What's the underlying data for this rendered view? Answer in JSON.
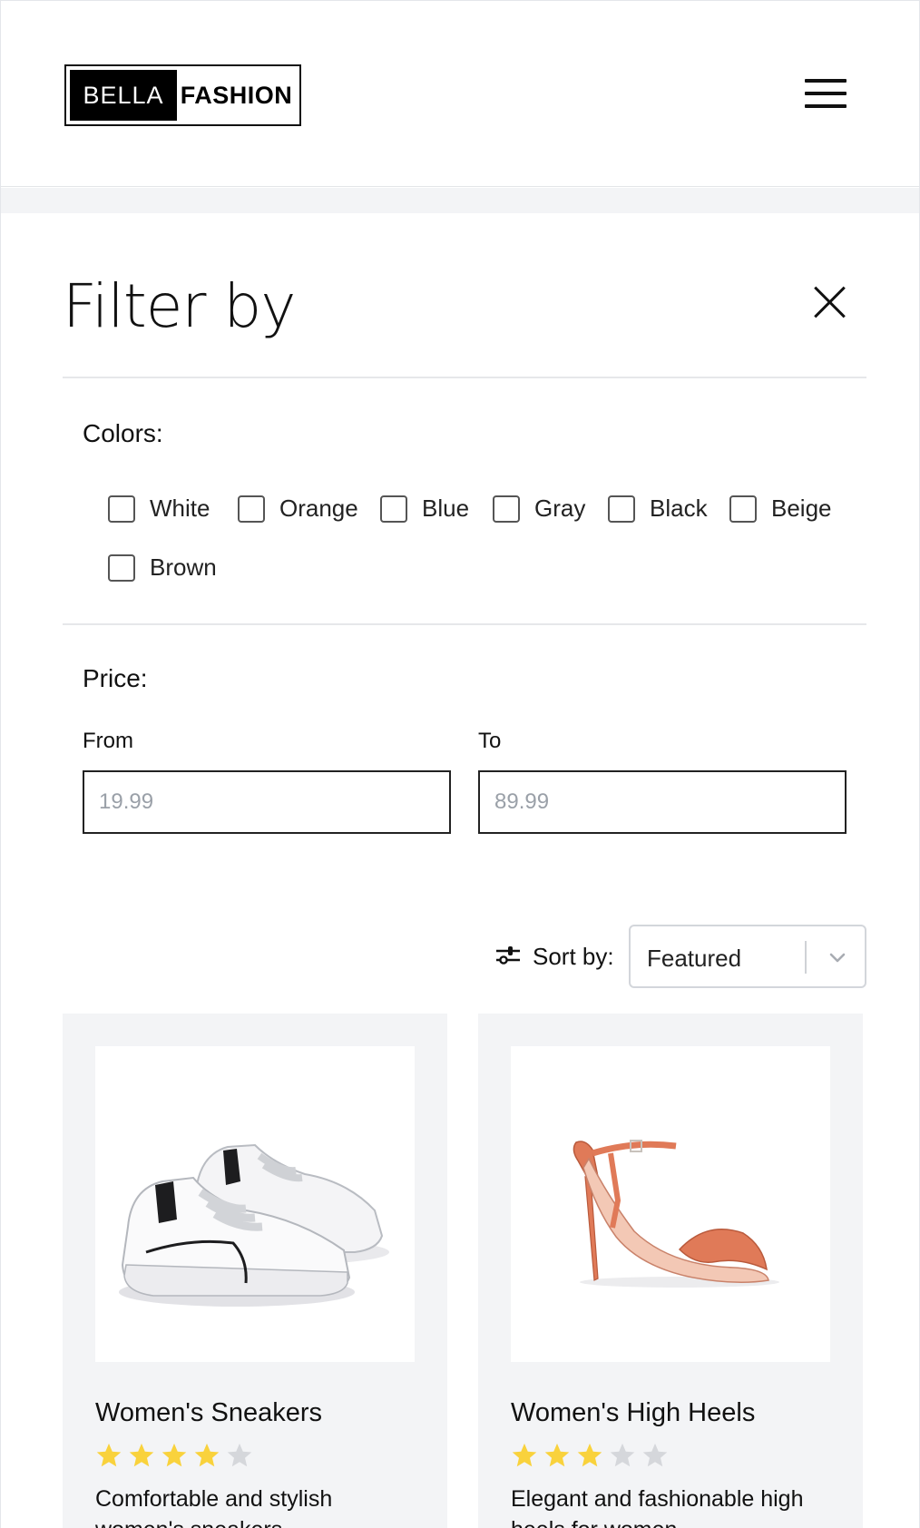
{
  "header": {
    "logo_left": "BELLA",
    "logo_right": "FASHION",
    "menu_icon": "hamburger-menu-icon"
  },
  "filter": {
    "title": "Filter by",
    "close_icon": "close-icon",
    "colors_label": "Colors:",
    "colors": [
      {
        "label": "White",
        "checked": false
      },
      {
        "label": "Orange",
        "checked": false
      },
      {
        "label": "Blue",
        "checked": false
      },
      {
        "label": "Gray",
        "checked": false
      },
      {
        "label": "Black",
        "checked": false
      },
      {
        "label": "Beige",
        "checked": false
      },
      {
        "label": "Brown",
        "checked": false
      }
    ],
    "price_label": "Price:",
    "from_label": "From",
    "from_placeholder": "19.99",
    "to_label": "To",
    "to_placeholder": "89.99"
  },
  "sort": {
    "icon": "sliders-icon",
    "label": "Sort by:",
    "selected": "Featured",
    "chevron_icon": "chevron-down-icon"
  },
  "products": [
    {
      "title": "Women's Sneakers",
      "rating": 4,
      "max_rating": 5,
      "description": "Comfortable and stylish women's sneakers",
      "image_icon": "sneaker-image"
    },
    {
      "title": "Women's High Heels",
      "rating": 3,
      "max_rating": 5,
      "description": "Elegant and fashionable high heels for women",
      "image_icon": "high-heel-image"
    }
  ],
  "colors": {
    "star_filled": "#f9d23c",
    "star_empty": "#d5d7db",
    "card_bg": "#f3f4f6",
    "heel_color": "#e07a58"
  }
}
